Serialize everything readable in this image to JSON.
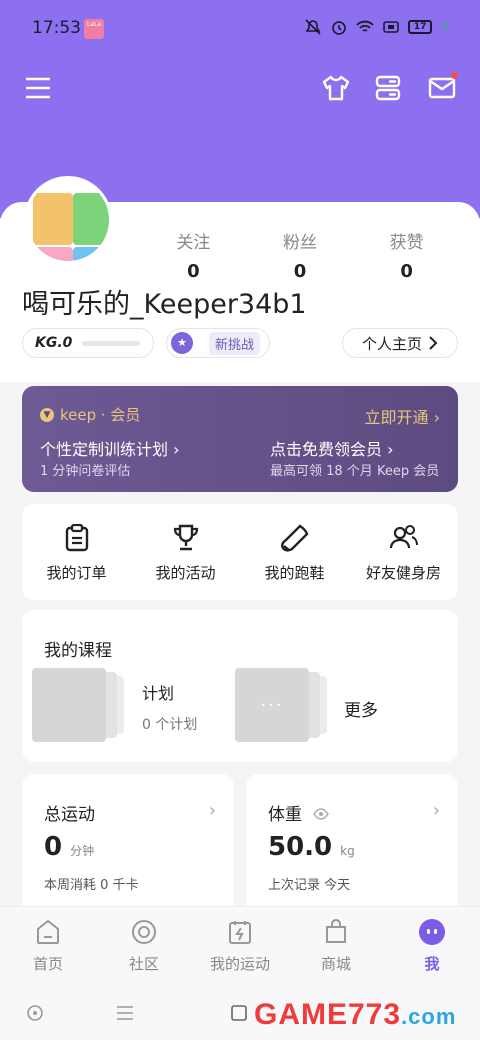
{
  "status_bar": {
    "time": "17:53",
    "app_badge": "LaLa",
    "battery": "17"
  },
  "header": {
    "icons": [
      "menu-icon",
      "shirt-icon",
      "server-icon",
      "mail-icon"
    ]
  },
  "profile": {
    "stats": [
      {
        "label": "关注",
        "value": "0"
      },
      {
        "label": "粉丝",
        "value": "0"
      },
      {
        "label": "获赞",
        "value": "0"
      }
    ],
    "username": "喝可乐的_Keeper34b1",
    "kg_level": "KG.0",
    "challenge_tag": "新挑战",
    "homepage_label": "个人主页"
  },
  "vip": {
    "brand": "keep · 会员",
    "open_label": "立即开通",
    "left_title": "个性定制训练计划",
    "left_sub": "1 分钟问卷评估",
    "right_title": "点击免费领会员",
    "right_sub": "最高可领 18 个月 Keep 会员"
  },
  "shortcuts": [
    {
      "label": "我的订单",
      "icon": "clipboard-icon"
    },
    {
      "label": "我的活动",
      "icon": "trophy-icon"
    },
    {
      "label": "我的跑鞋",
      "icon": "shoe-icon"
    },
    {
      "label": "好友健身房",
      "icon": "friends-icon"
    }
  ],
  "courses": {
    "title": "我的课程",
    "plan_title": "计划",
    "plan_sub": "0 个计划",
    "more_glyph": "···",
    "more_label": "更多"
  },
  "exercise": {
    "title": "总运动",
    "value": "0",
    "unit": "分钟",
    "sub": "本周消耗 0 千卡"
  },
  "weight": {
    "title": "体重",
    "value": "50.0",
    "unit": "kg",
    "sub": "上次记录 今天"
  },
  "tabs": [
    {
      "label": "首页",
      "icon": "home-icon"
    },
    {
      "label": "社区",
      "icon": "community-icon"
    },
    {
      "label": "我的运动",
      "icon": "sport-icon"
    },
    {
      "label": "商城",
      "icon": "shop-icon"
    },
    {
      "label": "我",
      "icon": "me-icon"
    }
  ],
  "watermark": {
    "main": "GAME773",
    "suffix": ".com"
  },
  "colors": {
    "brand": "#8c70f0",
    "accent": "#7b5ce8",
    "vip_gold": "#e9c47c"
  }
}
